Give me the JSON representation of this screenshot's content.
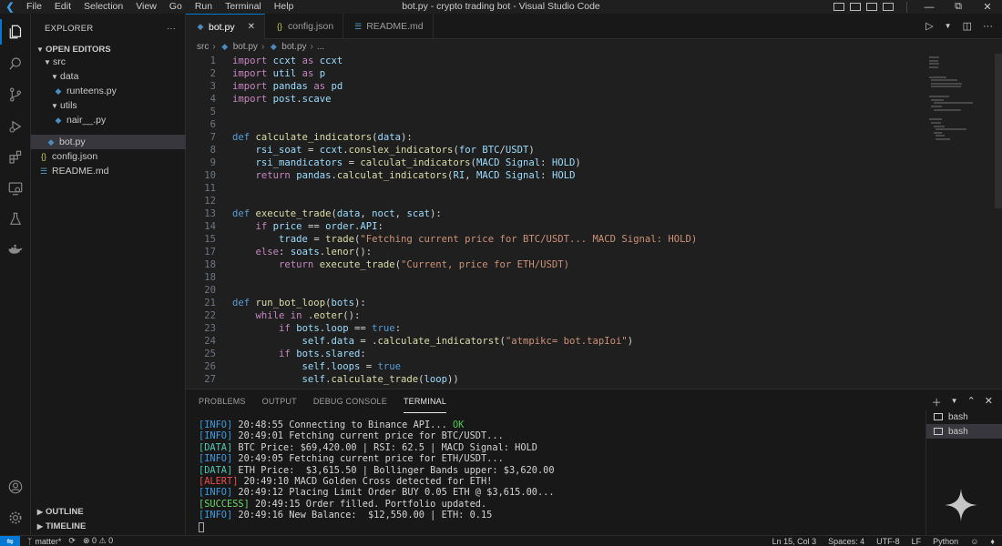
{
  "window": {
    "title": "bot.py - crypto trading bot - Visual Studio Code",
    "menu": [
      "File",
      "Edit",
      "Selection",
      "View",
      "Go",
      "Run",
      "Terminal",
      "Help"
    ]
  },
  "sidebar": {
    "header": "EXPLORER",
    "section": "OPEN EDITORS",
    "tree": [
      {
        "label": "src",
        "kind": "folder"
      },
      {
        "label": "data",
        "kind": "folder"
      },
      {
        "label": "runteens.py",
        "kind": "py"
      },
      {
        "label": "utils",
        "kind": "folder"
      },
      {
        "label": "nair__.py",
        "kind": "py"
      },
      {
        "label": "bot.py",
        "kind": "py"
      },
      {
        "label": "config.json",
        "kind": "json"
      },
      {
        "label": "README.md",
        "kind": "md"
      }
    ],
    "outline": "OUTLINE",
    "timeline": "TIMELINE"
  },
  "tabs": [
    {
      "label": "bot.py",
      "icon": "python-file-icon"
    },
    {
      "label": "config.json",
      "icon": "json-file-icon"
    },
    {
      "label": "README.md",
      "icon": "markdown-file-icon"
    }
  ],
  "breadcrumb": [
    "src",
    "bot.py",
    "bot.py",
    "..."
  ],
  "code": [
    {
      "n": "1",
      "t": "import ccxt as ccxt"
    },
    {
      "n": "2",
      "t": "import util as p"
    },
    {
      "n": "3",
      "t": "import pandas as pd"
    },
    {
      "n": "4",
      "t": "import post.scave"
    },
    {
      "n": "5",
      "t": ""
    },
    {
      "n": "6",
      "t": ""
    },
    {
      "n": "7",
      "t": "def calculate_indicators(data):"
    },
    {
      "n": "8",
      "t": "    rsi_soat = ccxt.conslex_indicators(for BTC/USDT)"
    },
    {
      "n": "9",
      "t": "    rsi_mandicators = calculat_indicators(MACD Signal: HOLD)"
    },
    {
      "n": "10",
      "t": "    return pandas.calculat_indicators(RI, MACD Signal: HOLD"
    },
    {
      "n": "11",
      "t": ""
    },
    {
      "n": "12",
      "t": ""
    },
    {
      "n": "13",
      "t": "def execute_trade(data, noct, scat):"
    },
    {
      "n": "14",
      "t": "    if price == order.API:"
    },
    {
      "n": "15",
      "t": "        trade = trade(\"Fetching current price for BTC/USDT... MACD Signal: HOLD)"
    },
    {
      "n": "17",
      "t": "    else: soats.lenor():"
    },
    {
      "n": "18",
      "t": "        return execute_trade(\"Current, price for ETH/USDT)"
    },
    {
      "n": "18",
      "t": ""
    },
    {
      "n": "20",
      "t": ""
    },
    {
      "n": "21",
      "t": "def run_bot_loop(bots):"
    },
    {
      "n": "22",
      "t": "    while in .eoter():"
    },
    {
      "n": "23",
      "t": "        if bots.loop == true:"
    },
    {
      "n": "24",
      "t": "            self.data = .calculate_indicatorst(\"atmpikc= bot.tapIoi\")"
    },
    {
      "n": "25",
      "t": "        if bots.slared:"
    },
    {
      "n": "26",
      "t": "            self.loops = true"
    },
    {
      "n": "27",
      "t": "            self.calculate_trade(loop))"
    }
  ],
  "panel": {
    "tabs": [
      "PROBLEMS",
      "OUTPUT",
      "DEBUG CONSOLE",
      "TERMINAL"
    ],
    "terminal_lines": [
      {
        "tag": "[INFO]",
        "kind": "info",
        "text": " 20:48:55 Connecting to Binance API... ",
        "suffix": "OK"
      },
      {
        "tag": "[INFO]",
        "kind": "info",
        "text": " 20:49:01 Fetching current price for BTC/USDT...",
        "suffix": ""
      },
      {
        "tag": "[DATA]",
        "kind": "data",
        "text": " BTC Price: $69,420.00 | RSI: 62.5 | MACD Signal: HOLD",
        "suffix": ""
      },
      {
        "tag": "[INFO]",
        "kind": "info",
        "text": " 20:49:05 Fetching current price for ETH/USDT...",
        "suffix": ""
      },
      {
        "tag": "[DATA]",
        "kind": "data",
        "text": " ETH Price:  $3,615.50 | Bollinger Bands upper: $3,620.00",
        "suffix": ""
      },
      {
        "tag": "[ALERT]",
        "kind": "alert",
        "text": " 20:49:10 MACD Golden Cross detected for ETH!",
        "suffix": ""
      },
      {
        "tag": "[INFO]",
        "kind": "info",
        "text": " 20:49:12 Placing Limit Order BUY 0.05 ETH @ $3,615.00...",
        "suffix": ""
      },
      {
        "tag": "[SUCCESS]",
        "kind": "success",
        "text": " 20:49:15 Order filled. Portfolio updated.",
        "suffix": ""
      },
      {
        "tag": "[INFO]",
        "kind": "info",
        "text": " 20:49:16 New Balance:  $12,550.00 | ETH: 0.15",
        "suffix": ""
      }
    ],
    "terminals": [
      "bash",
      "bash"
    ]
  },
  "statusbar": {
    "branch": "matter*",
    "problems": "⊗ 0 ⚠ 0",
    "position": "Ln 15, Col 3",
    "spaces": "Spaces: 4",
    "encoding": "UTF-8",
    "eol": "LF",
    "language": "Python"
  },
  "colors": {
    "accent": "#0078d4",
    "info": "#3b9ee5",
    "data": "#4ec9b0",
    "alert": "#f14c4c",
    "success": "#6bd96b"
  }
}
